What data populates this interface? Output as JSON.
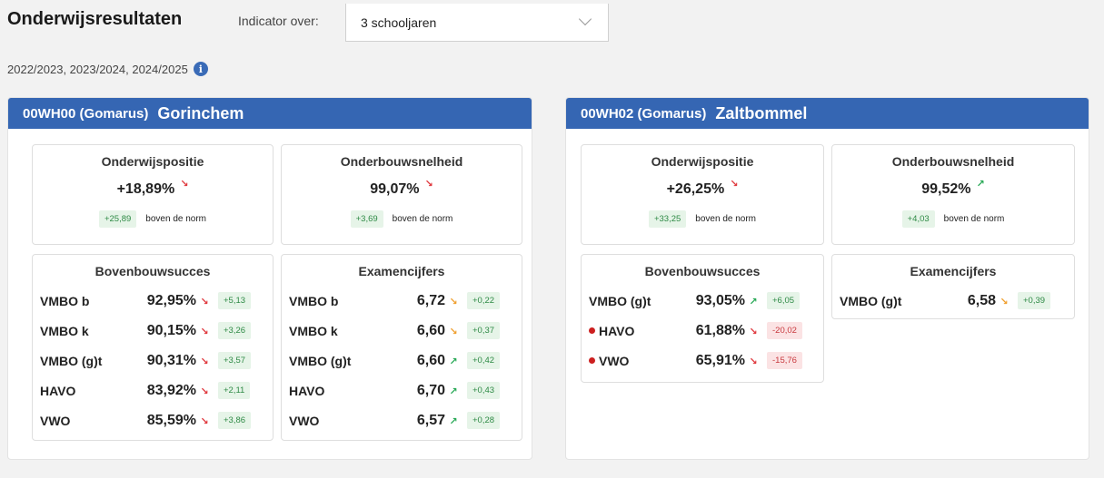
{
  "header": {
    "title": "Onderwijsresultaten",
    "indicator_label": "Indicator over:",
    "indicator_value": "3 schooljaren",
    "years": "2022/2023, 2023/2024, 2024/2025",
    "info_icon": "info-icon"
  },
  "colors": {
    "panel_header": "#3566b3",
    "down": "#e0393e",
    "up": "#2aa957",
    "flat": "#f0a030",
    "pill_pos_bg": "#e6f4e8",
    "pill_neg_bg": "#fbe3e4"
  },
  "panels": [
    {
      "code": "00WH00 (Gomarus)",
      "city": "Gorinchem",
      "onderwijspositie": {
        "title": "Onderwijspositie",
        "value": "+18,89%",
        "trend": "down",
        "norm_diff": "+25,89",
        "norm_label": "boven de norm"
      },
      "onderbouwsnelheid": {
        "title": "Onderbouwsnelheid",
        "value": "99,07%",
        "trend": "down",
        "norm_diff": "+3,69",
        "norm_label": "boven de norm"
      },
      "bovenbouwsucces": {
        "title": "Bovenbouwsucces",
        "rows": [
          {
            "label": "VMBO b",
            "value": "92,95%",
            "trend": "down",
            "diff": "+5,13"
          },
          {
            "label": "VMBO k",
            "value": "90,15%",
            "trend": "down",
            "diff": "+3,26"
          },
          {
            "label": "VMBO (g)t",
            "value": "90,31%",
            "trend": "down",
            "diff": "+3,57"
          },
          {
            "label": "HAVO",
            "value": "83,92%",
            "trend": "down",
            "diff": "+2,11"
          },
          {
            "label": "VWO",
            "value": "85,59%",
            "trend": "down",
            "diff": "+3,86"
          }
        ]
      },
      "examencijfers": {
        "title": "Examencijfers",
        "rows": [
          {
            "label": "VMBO b",
            "value": "6,72",
            "trend": "flat",
            "diff": "+0,22"
          },
          {
            "label": "VMBO k",
            "value": "6,60",
            "trend": "flat",
            "diff": "+0,37"
          },
          {
            "label": "VMBO (g)t",
            "value": "6,60",
            "trend": "up",
            "diff": "+0,42"
          },
          {
            "label": "HAVO",
            "value": "6,70",
            "trend": "up",
            "diff": "+0,43"
          },
          {
            "label": "VWO",
            "value": "6,57",
            "trend": "up",
            "diff": "+0,28"
          }
        ]
      }
    },
    {
      "code": "00WH02 (Gomarus)",
      "city": "Zaltbommel",
      "onderwijspositie": {
        "title": "Onderwijspositie",
        "value": "+26,25%",
        "trend": "down",
        "norm_diff": "+33,25",
        "norm_label": "boven de norm"
      },
      "onderbouwsnelheid": {
        "title": "Onderbouwsnelheid",
        "value": "99,52%",
        "trend": "up",
        "norm_diff": "+4,03",
        "norm_label": "boven de norm"
      },
      "bovenbouwsucces": {
        "title": "Bovenbouwsucces",
        "rows": [
          {
            "label": "VMBO (g)t",
            "value": "93,05%",
            "trend": "up",
            "diff": "+6,05",
            "dot": false
          },
          {
            "label": "HAVO",
            "value": "61,88%",
            "trend": "down",
            "diff": "-20,02",
            "dot": true
          },
          {
            "label": "VWO",
            "value": "65,91%",
            "trend": "down",
            "diff": "-15,76",
            "dot": true
          }
        ]
      },
      "examencijfers": {
        "title": "Examencijfers",
        "rows": [
          {
            "label": "VMBO (g)t",
            "value": "6,58",
            "trend": "flat",
            "diff": "+0,39"
          }
        ]
      }
    }
  ]
}
